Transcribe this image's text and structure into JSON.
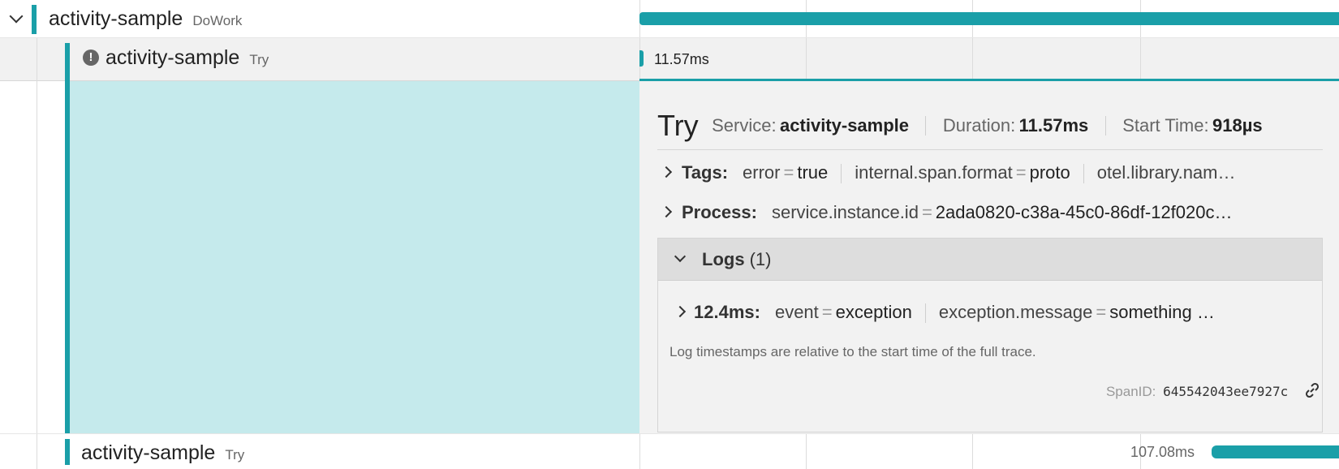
{
  "rows": [
    {
      "service": "activity-sample",
      "operation": "DoWork"
    },
    {
      "service": "activity-sample",
      "operation": "Try",
      "duration": "11.57ms",
      "has_error": true
    },
    {
      "service": "activity-sample",
      "operation": "Try",
      "duration": "107.08ms"
    }
  ],
  "detail": {
    "title": "Try",
    "service_label": "Service:",
    "service_value": "activity-sample",
    "duration_label": "Duration:",
    "duration_value": "11.57ms",
    "start_label": "Start Time:",
    "start_value": "918µs",
    "tags_label": "Tags:",
    "tags": [
      {
        "key": "error",
        "value": "true"
      },
      {
        "key": "internal.span.format",
        "value": "proto"
      },
      {
        "key": "otel.library.nam…",
        "value": ""
      }
    ],
    "process_label": "Process:",
    "process": [
      {
        "key": "service.instance.id",
        "value": "2ada0820-c38a-45c0-86df-12f020c…"
      }
    ],
    "logs_label": "Logs",
    "logs_count": "(1)",
    "log_entry": {
      "time": "12.4ms:",
      "fields": [
        {
          "key": "event",
          "value": "exception"
        },
        {
          "key": "exception.message",
          "value": "something …"
        }
      ]
    },
    "log_note": "Log timestamps are relative to the start time of the full trace.",
    "spanid_label": "SpanID:",
    "spanid_value": "645542043ee7927c"
  },
  "colors": {
    "accent": "#1a9fa8",
    "selected_bg": "#c5eaec",
    "panel_bg": "#f2f2f2"
  }
}
